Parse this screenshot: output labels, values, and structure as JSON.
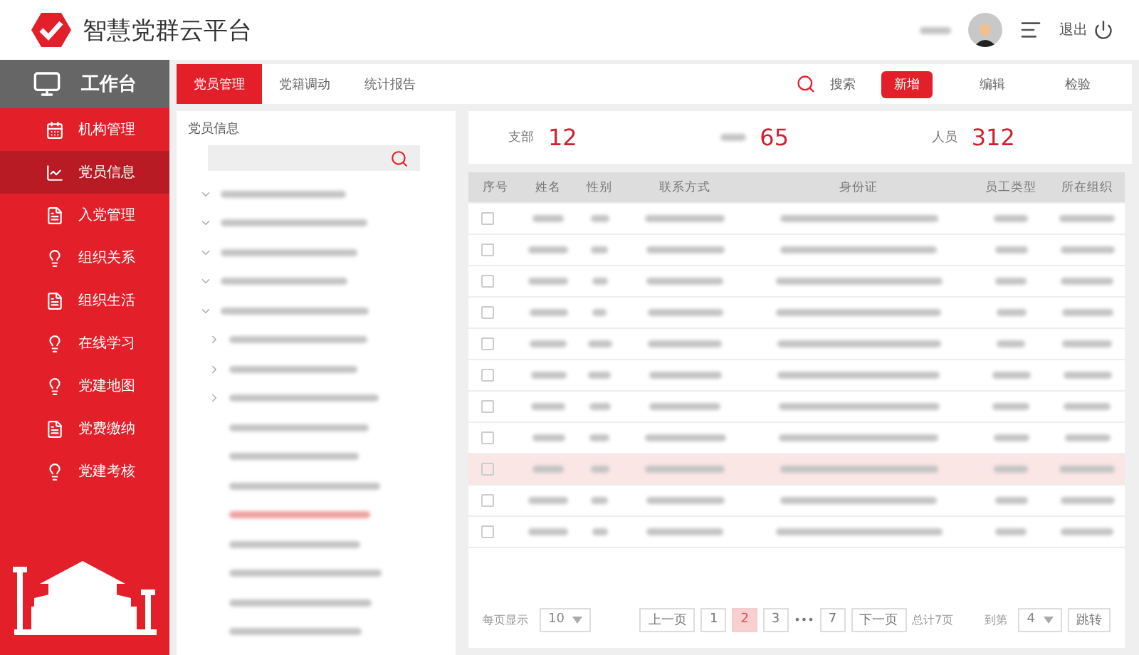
{
  "header": {
    "title": "智慧党群云平台",
    "logout": "退出"
  },
  "sidebar": {
    "title": "工作台",
    "items": [
      {
        "label": "机构管理",
        "selected": false
      },
      {
        "label": "党员信息",
        "selected": true
      },
      {
        "label": "入党管理",
        "selected": false
      },
      {
        "label": "组织关系",
        "selected": false
      },
      {
        "label": "组织生活",
        "selected": false
      },
      {
        "label": "在线学习",
        "selected": false
      },
      {
        "label": "党建地图",
        "selected": false
      },
      {
        "label": "党费缴纳",
        "selected": false
      },
      {
        "label": "党建考核",
        "selected": false
      }
    ]
  },
  "tabs": [
    {
      "label": "党员管理",
      "selected": true
    },
    {
      "label": "党籍调动",
      "selected": false
    },
    {
      "label": "统计报告",
      "selected": false
    }
  ],
  "toolbar": {
    "search": "搜索",
    "buttons": [
      {
        "label": "新增",
        "kind": "primary"
      },
      {
        "label": "编辑",
        "kind": "plain"
      },
      {
        "label": "检验",
        "kind": "plain"
      }
    ]
  },
  "tree_panel": {
    "title": "党员信息",
    "nodes": [
      {
        "kind": "branch",
        "expanded": true,
        "selected": false
      },
      {
        "kind": "branch",
        "expanded": true,
        "selected": false
      },
      {
        "kind": "branch",
        "expanded": true,
        "selected": false
      },
      {
        "kind": "branch",
        "expanded": true,
        "selected": false
      },
      {
        "kind": "branch",
        "expanded": true,
        "selected": false,
        "children": [
          {
            "kind": "branch",
            "expanded": false,
            "selected": false
          },
          {
            "kind": "branch",
            "expanded": false,
            "selected": false
          },
          {
            "kind": "branch",
            "expanded": false,
            "selected": false
          },
          {
            "kind": "leaf",
            "selected": false
          },
          {
            "kind": "leaf",
            "selected": false
          },
          {
            "kind": "leaf",
            "selected": false
          },
          {
            "kind": "leaf",
            "selected": true
          },
          {
            "kind": "leaf",
            "selected": false
          },
          {
            "kind": "leaf",
            "selected": false
          },
          {
            "kind": "leaf",
            "selected": false
          },
          {
            "kind": "leaf",
            "selected": false
          }
        ]
      }
    ]
  },
  "stats": [
    {
      "label": "支部",
      "value": "12"
    },
    {
      "value": "65"
    },
    {
      "label": "人员",
      "value": "312"
    }
  ],
  "table": {
    "columns": [
      "序号",
      "姓名",
      "性别",
      "联系方式",
      "身份证",
      "员工类型",
      "所在组织"
    ],
    "rows": [
      {
        "checked": false,
        "selected": false
      },
      {
        "checked": false,
        "selected": false
      },
      {
        "checked": false,
        "selected": false
      },
      {
        "checked": false,
        "selected": false
      },
      {
        "checked": false,
        "selected": false
      },
      {
        "checked": false,
        "selected": false
      },
      {
        "checked": false,
        "selected": false
      },
      {
        "checked": false,
        "selected": false
      },
      {
        "checked": false,
        "selected": true
      },
      {
        "checked": false,
        "selected": false
      },
      {
        "checked": false,
        "selected": false
      }
    ]
  },
  "pagination": {
    "per_page_label": "每页显示",
    "per_page": "10",
    "prev": "上一页",
    "pages": [
      {
        "label": "1",
        "selected": false
      },
      {
        "label": "2",
        "selected": true
      },
      {
        "label": "3",
        "selected": false
      }
    ],
    "ellipsis": "•••",
    "last": {
      "label": "7",
      "selected": false
    },
    "next": "下一页",
    "total": "总计7页",
    "goto_label": "到第",
    "goto_page": "4",
    "goto_button": "跳转"
  }
}
